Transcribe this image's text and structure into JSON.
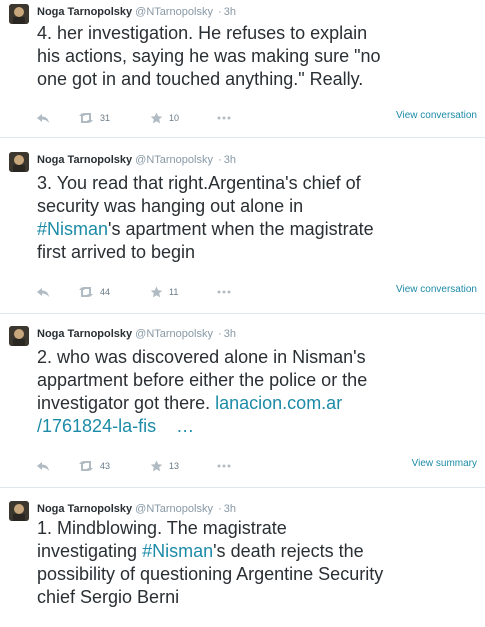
{
  "colors": {
    "link": "#1c8ba7",
    "text": "#292f33",
    "meta": "#8899a6",
    "separator": "#e1e8ed"
  },
  "tweets": [
    {
      "name": "Noga Tarnopolsky",
      "handle": "@NTarnopolsky",
      "dot": "·",
      "time": "3h",
      "lines": [
        "4. her investigation. He refuses to explain",
        "his actions, saying he was making sure \"no",
        "one got in and touched anything.\" Really."
      ],
      "retweets": "31",
      "favorites": "10",
      "view": "View conversation"
    },
    {
      "name": "Noga Tarnopolsky",
      "handle": "@NTarnopolsky",
      "dot": "·",
      "time": "3h",
      "lines": [
        "3. You read that right.Argentina's chief of",
        "security was hanging out alone in",
        "'s apartment when the magistrate",
        "first arrived to begin"
      ],
      "hashtag": "#Nisman",
      "retweets": "44",
      "favorites": "11",
      "view": "View conversation"
    },
    {
      "name": "Noga Tarnopolsky",
      "handle": "@NTarnopolsky",
      "dot": "·",
      "time": "3h",
      "lines": [
        "2. who was discovered alone in Nisman's",
        "appartment before either the police or the",
        "investigator got there."
      ],
      "link_part1": "lanacion.com.ar",
      "link_part2": "/1761824-la-fis",
      "link_ellipsis": "…",
      "retweets": "43",
      "favorites": "13",
      "view": "View summary"
    },
    {
      "name": "Noga Tarnopolsky",
      "handle": "@NTarnopolsky",
      "dot": "·",
      "time": "3h",
      "lines": [
        "1. Mindblowing. The magistrate",
        "investigating",
        "'s death rejects the",
        "possibility of questioning Argentine Security",
        "chief Sergio Berni"
      ],
      "hashtag": "#Nisman"
    }
  ]
}
